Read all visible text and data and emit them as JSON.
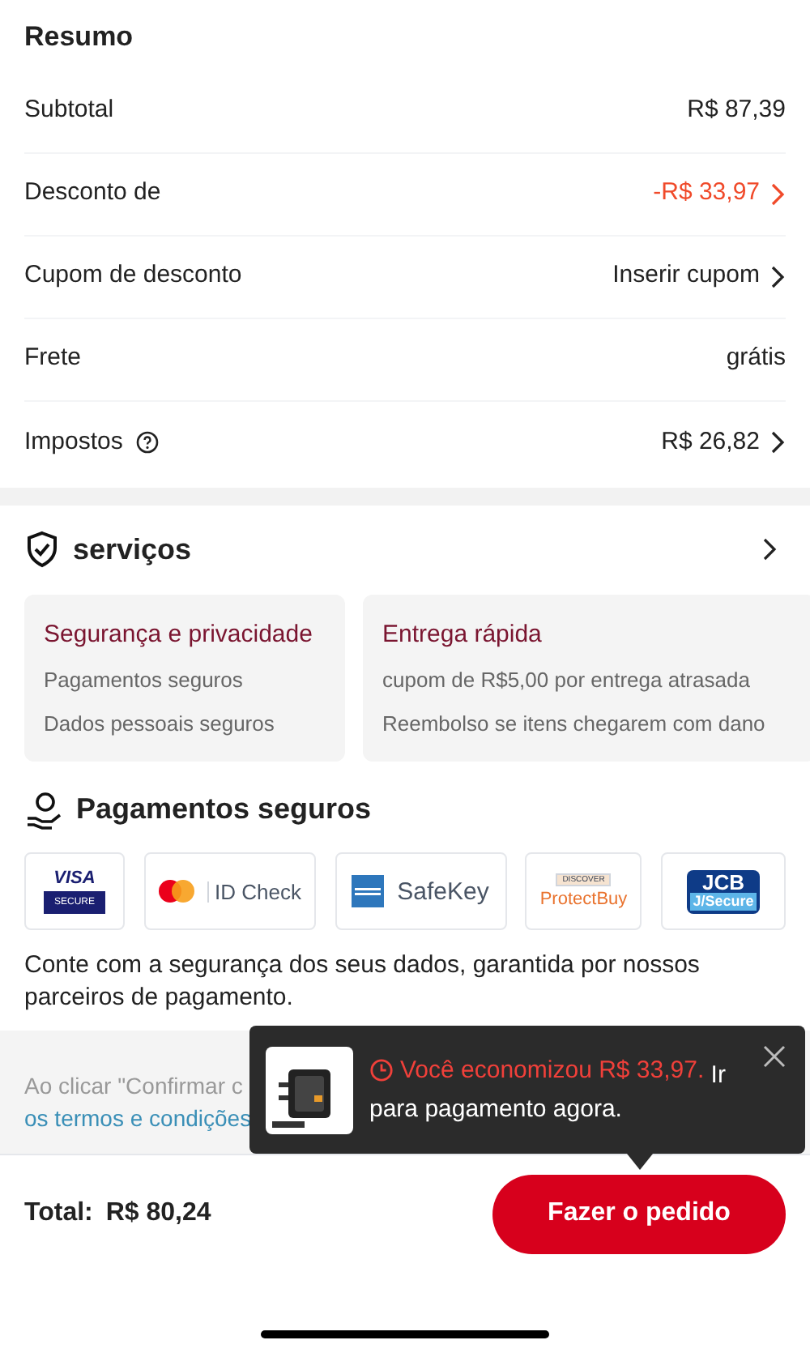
{
  "summary": {
    "title": "Resumo",
    "rows": [
      {
        "label": "Subtotal",
        "value": "R$ 87,39",
        "kind": "plain",
        "help": false,
        "chevron": false
      },
      {
        "label": "Desconto de",
        "value": "-R$ 33,97",
        "kind": "discount",
        "help": false,
        "chevron": true
      },
      {
        "label": "Cupom de desconto",
        "value": "Inserir cupom",
        "kind": "plain",
        "help": false,
        "chevron": true
      },
      {
        "label": "Frete",
        "value": "grátis",
        "kind": "plain",
        "help": false,
        "chevron": false
      },
      {
        "label": "Impostos",
        "value": "R$ 26,82",
        "kind": "plain",
        "help": true,
        "chevron": true
      }
    ]
  },
  "services": {
    "title": "serviços",
    "cards": [
      {
        "title": "Segurança e privacidade",
        "lines": [
          "Pagamentos seguros",
          "Dados pessoais seguros"
        ]
      },
      {
        "title": "Entrega rápida",
        "lines": [
          "cupom de R$5,00 por entrega atrasada",
          "Reembolso se itens chegarem com dano"
        ]
      }
    ]
  },
  "payments": {
    "title": "Pagamentos seguros",
    "logos": [
      {
        "kind": "visa",
        "texts": [
          "VISA",
          "SECURE"
        ]
      },
      {
        "kind": "mastercard",
        "texts": [
          "ID Check"
        ]
      },
      {
        "kind": "amex",
        "texts": [
          "SafeKey"
        ]
      },
      {
        "kind": "discover",
        "texts": [
          "DISCOVER",
          "ProtectBuy"
        ]
      },
      {
        "kind": "jcb",
        "texts": [
          "JCB",
          "J/Secure"
        ]
      }
    ],
    "note": "Conte com a segurança dos seus dados, garantida por nossos parceiros de pagamento."
  },
  "terms": {
    "text": "Ao clicar \"Confirmar c",
    "link": "os termos e condições"
  },
  "popup": {
    "highlight": "Você economizou R$ 33,97.",
    "text": " Ir para pagamento agora."
  },
  "footer": {
    "total_label": "Total:",
    "total_value": "R$ 80,24",
    "button": "Fazer o pedido"
  }
}
